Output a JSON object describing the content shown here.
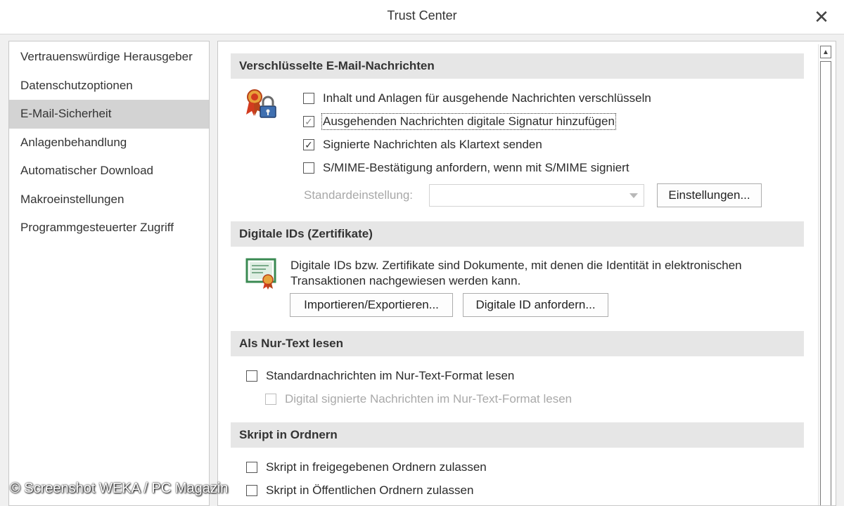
{
  "window": {
    "title": "Trust Center",
    "close_glyph": "✕"
  },
  "sidebar": {
    "items": [
      {
        "label": "Vertrauenswürdige Herausgeber",
        "active": false
      },
      {
        "label": "Datenschutzoptionen",
        "active": false
      },
      {
        "label": "E-Mail-Sicherheit",
        "active": true
      },
      {
        "label": "Anlagenbehandlung",
        "active": false
      },
      {
        "label": "Automatischer Download",
        "active": false
      },
      {
        "label": "Makroeinstellungen",
        "active": false
      },
      {
        "label": "Programmgesteuerter Zugriff",
        "active": false
      }
    ]
  },
  "sections": {
    "encrypted": {
      "header": "Verschlüsselte E-Mail-Nachrichten",
      "icon": "certificate-lock-icon",
      "options": [
        {
          "label": "Inhalt und Anlagen für ausgehende Nachrichten verschlüsseln",
          "checked": false
        },
        {
          "label": "Ausgehenden Nachrichten digitale Signatur hinzufügen",
          "checked": true
        },
        {
          "label": "Signierte Nachrichten als Klartext senden",
          "checked": true
        },
        {
          "label": "S/MIME-Bestätigung anfordern, wenn mit S/MIME signiert",
          "checked": false
        }
      ],
      "default_setting_label": "Standardeinstellung:",
      "default_setting_value": "",
      "settings_button": "Einstellungen..."
    },
    "digital_ids": {
      "header": "Digitale IDs (Zertifikate)",
      "icon": "certificate-icon",
      "description_line1": "Digitale IDs bzw. Zertifikate sind Dokumente, mit denen die Identität in elektronischen",
      "description_line2": "Transaktionen nachgewiesen werden kann.",
      "import_export_button": "Importieren/Exportieren...",
      "request_id_button": "Digitale ID anfordern..."
    },
    "plain_text": {
      "header": "Als Nur-Text lesen",
      "options": [
        {
          "label": "Standardnachrichten im Nur-Text-Format lesen",
          "checked": false,
          "enabled": true
        },
        {
          "label": "Digital signierte Nachrichten im Nur-Text-Format lesen",
          "checked": false,
          "enabled": false
        }
      ]
    },
    "script": {
      "header": "Skript in Ordnern",
      "options": [
        {
          "label": "Skript in freigegebenen Ordnern zulassen",
          "checked": false
        },
        {
          "label": "Skript in Öffentlichen Ordnern zulassen",
          "checked": false
        }
      ]
    }
  },
  "watermark": "© Screenshot WEKA / PC Magazin",
  "colors": {
    "sidebar_active": "#d3d3d3",
    "section_header_bg": "#e6e6e6",
    "disabled_text": "#a8a8a8"
  }
}
